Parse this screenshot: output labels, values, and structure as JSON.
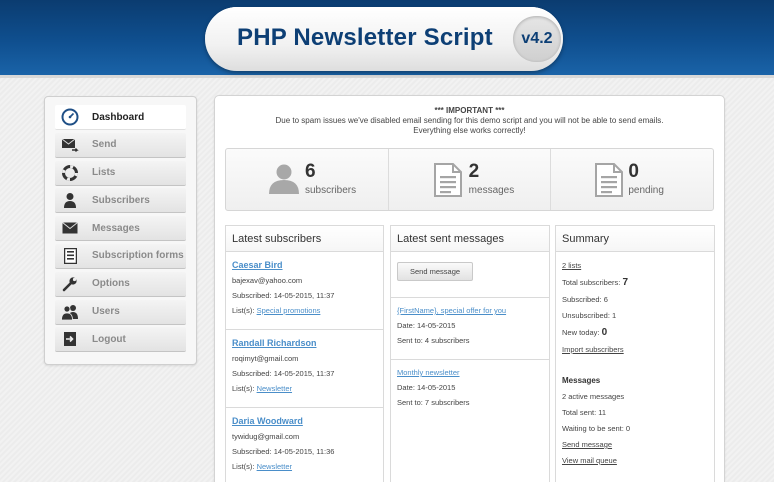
{
  "header": {
    "title": "PHP Newsletter Script",
    "version": "v4.2"
  },
  "sidebar": {
    "items": [
      {
        "label": "Dashboard",
        "icon": "dashboard-gauge-icon",
        "active": true
      },
      {
        "label": "Send",
        "icon": "envelope-send-icon"
      },
      {
        "label": "Lists",
        "icon": "lifebuoy-icon"
      },
      {
        "label": "Subscribers",
        "icon": "person-icon"
      },
      {
        "label": "Messages",
        "icon": "envelope-icon"
      },
      {
        "label": "Subscription forms",
        "icon": "form-icon"
      },
      {
        "label": "Options",
        "icon": "wrench-icon"
      },
      {
        "label": "Users",
        "icon": "users-icon"
      },
      {
        "label": "Logout",
        "icon": "logout-icon"
      }
    ]
  },
  "notice": {
    "title": "*** IMPORTANT ***",
    "line1": "Due to spam issues we've disabled email sending for this demo script and you will not be able to send emails.",
    "line2": "Everything else works correctly!"
  },
  "stats": [
    {
      "value": "6",
      "label": "subscribers",
      "icon": "person-icon"
    },
    {
      "value": "2",
      "label": "messages",
      "icon": "document-icon"
    },
    {
      "value": "0",
      "label": "pending",
      "icon": "document-icon"
    }
  ],
  "latest_subscribers": {
    "title": "Latest subscribers",
    "items": [
      {
        "name": "Caesar Bird",
        "email": "bajexav@yahoo.com",
        "subscribed": "Subscribed: 14-05-2015, 11:37",
        "lists_label": "List(s):",
        "list": "Special promotions"
      },
      {
        "name": "Randall Richardson",
        "email": "roqimyt@gmail.com",
        "subscribed": "Subscribed: 14-05-2015, 11:37",
        "lists_label": "List(s):",
        "list": "Newsletter"
      },
      {
        "name": "Daria Woodward",
        "email": "tywidug@gmail.com",
        "subscribed": "Subscribed: 14-05-2015, 11:36",
        "lists_label": "List(s):",
        "list": "Newsletter"
      }
    ]
  },
  "latest_messages": {
    "title": "Latest sent messages",
    "button": "Send message",
    "items": [
      {
        "subject": "{FirstName}, special offer for you",
        "date": "Date: 14-05-2015",
        "sent": "Sent to: 4 subscribers"
      },
      {
        "subject": "Monthly newsletter",
        "date": "Date: 14-05-2015",
        "sent": "Sent to: 7 subscribers"
      }
    ]
  },
  "summary": {
    "title": "Summary",
    "lists_link": "2 lists",
    "total_label": "Total subscribers:",
    "total_value": "7",
    "subscribed": "Subscribed: 6",
    "unsubscribed": "Unsubscribed: 1",
    "new_today_label": "New today:",
    "new_today_value": "0",
    "import_link": "Import subscribers",
    "messages_heading": "Messages",
    "active": "2 active messages",
    "total_sent": "Total sent: 11",
    "waiting": "Waiting to be sent: 0",
    "send_link": "Send message",
    "queue_link": "View mail queue"
  },
  "colors": {
    "header_blue": "#0f4f8f",
    "title_blue": "#0d3f75",
    "link_blue": "#4a8ec9"
  }
}
